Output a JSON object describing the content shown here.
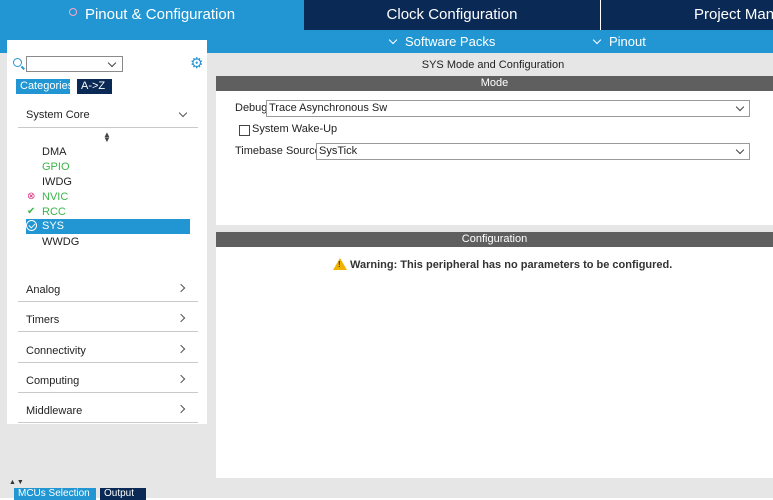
{
  "top_tabs": {
    "pinout": "Pinout & Configuration",
    "clock": "Clock Configuration",
    "project": "Project Manager"
  },
  "sub_menu": {
    "software_packs": "Software Packs",
    "pinout": "Pinout"
  },
  "left": {
    "search_value": "",
    "category_tabs": [
      "Categories",
      "A->Z"
    ],
    "system_core": {
      "label": "System Core",
      "peripherals": [
        {
          "label": "DMA",
          "status": "none"
        },
        {
          "label": "GPIO",
          "status": "configured"
        },
        {
          "label": "IWDG",
          "status": "none"
        },
        {
          "label": "NVIC",
          "status": "warning"
        },
        {
          "label": "RCC",
          "status": "ok"
        },
        {
          "label": "SYS",
          "status": "selected"
        },
        {
          "label": "WWDG",
          "status": "none"
        }
      ]
    },
    "groups": [
      "Analog",
      "Timers",
      "Connectivity",
      "Computing",
      "Middleware"
    ]
  },
  "right": {
    "title": "SYS Mode and Configuration",
    "mode_header": "Mode",
    "debug_label": "Debug",
    "debug_value": "Trace Asynchronous Sw",
    "wakeup_label": "System Wake-Up",
    "wakeup_checked": false,
    "timebase_label": "Timebase Source",
    "timebase_value": "SysTick",
    "config_header": "Configuration",
    "warning": "Warning: This peripheral has no parameters to be configured."
  },
  "bottom_tabs": [
    "MCUs Selection",
    "Output"
  ],
  "colors": {
    "accent": "#2196d3",
    "navy": "#0a2a55",
    "section_header": "#5f5f5f",
    "ok_green": "#3bb54a",
    "warn_pink": "#d6337e",
    "warning_yellow": "#f0b400"
  }
}
